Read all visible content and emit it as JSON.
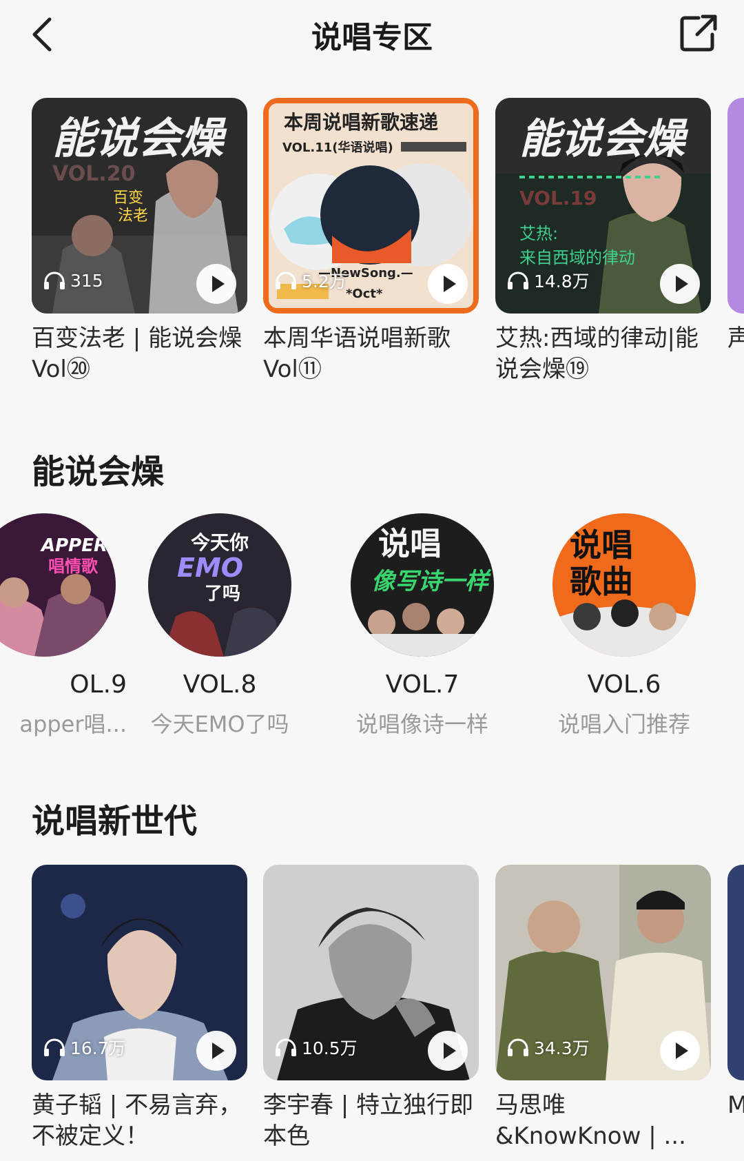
{
  "header": {
    "title": "说唱专区",
    "back_icon": "chevron-left-icon",
    "share_icon": "share-external-icon"
  },
  "top_row": [
    {
      "title": "百变法老 | 能说会燥Vol⑳",
      "play_count": "315",
      "cover_text": "能说会燥",
      "cover_sub": "百变法老",
      "cover_vol": "VOL.20",
      "bg": "#2b2b2b",
      "accent": "#b38a7a"
    },
    {
      "title": "本周华语说唱新歌Vol⑪",
      "play_count": "5.2万",
      "cover_text": "本周说唱新歌速递",
      "cover_sub": "VOL.11(华语说唱)",
      "cover_vol": "NewSong.",
      "bg": "#f3e1d0",
      "accent": "#ee6a1c"
    },
    {
      "title": "艾热:西域的律动|能说会燥⑲",
      "play_count": "14.8万",
      "cover_text": "能说会燥",
      "cover_sub": "艾热:来自西域的律动",
      "cover_vol": "VOL.19",
      "bg": "#1e2a24",
      "accent": "#3fcf8e"
    },
    {
      "title": "声",
      "play_count": "",
      "cover_text": "",
      "cover_sub": "",
      "cover_vol": "",
      "bg": "#b48ae0",
      "accent": "#ffffff"
    }
  ],
  "section2": {
    "title": "能说会燥",
    "items": [
      {
        "vol": "OL.9",
        "sub": "apper唱...",
        "cover_text": "APPER",
        "bg": "#3a1838",
        "accent": "#ff4fb3"
      },
      {
        "vol": "VOL.8",
        "sub": "今天EMO了吗",
        "cover_text": "EMO",
        "bg": "#2a2530",
        "accent": "#9d8cff"
      },
      {
        "vol": "VOL.7",
        "sub": "说唱像诗一样",
        "cover_text": "说唱",
        "bg": "#1d1d1d",
        "accent": "#39d66f"
      },
      {
        "vol": "VOL.6",
        "sub": "说唱入门推荐",
        "cover_text": "说唱歌曲",
        "bg": "#f06a1c",
        "accent": "#111111"
      }
    ]
  },
  "section3": {
    "title": "说唱新世代",
    "items": [
      {
        "title": "黄子韬 | 不易言弃，不被定义！",
        "play_count": "16.7万",
        "bg": "#1d2748",
        "accent": "#d8d6e6"
      },
      {
        "title": "李宇春 | 特立独行即本色",
        "play_count": "10.5万",
        "bg": "#8a8a8a",
        "accent": "#f4f4f4"
      },
      {
        "title": "马思唯&KnowKnow | ...",
        "play_count": "34.3万",
        "bg": "#c8c3b9",
        "accent": "#5f6b3c"
      },
      {
        "title": "M就",
        "play_count": "",
        "bg": "#304070",
        "accent": "#ffffff"
      }
    ]
  }
}
